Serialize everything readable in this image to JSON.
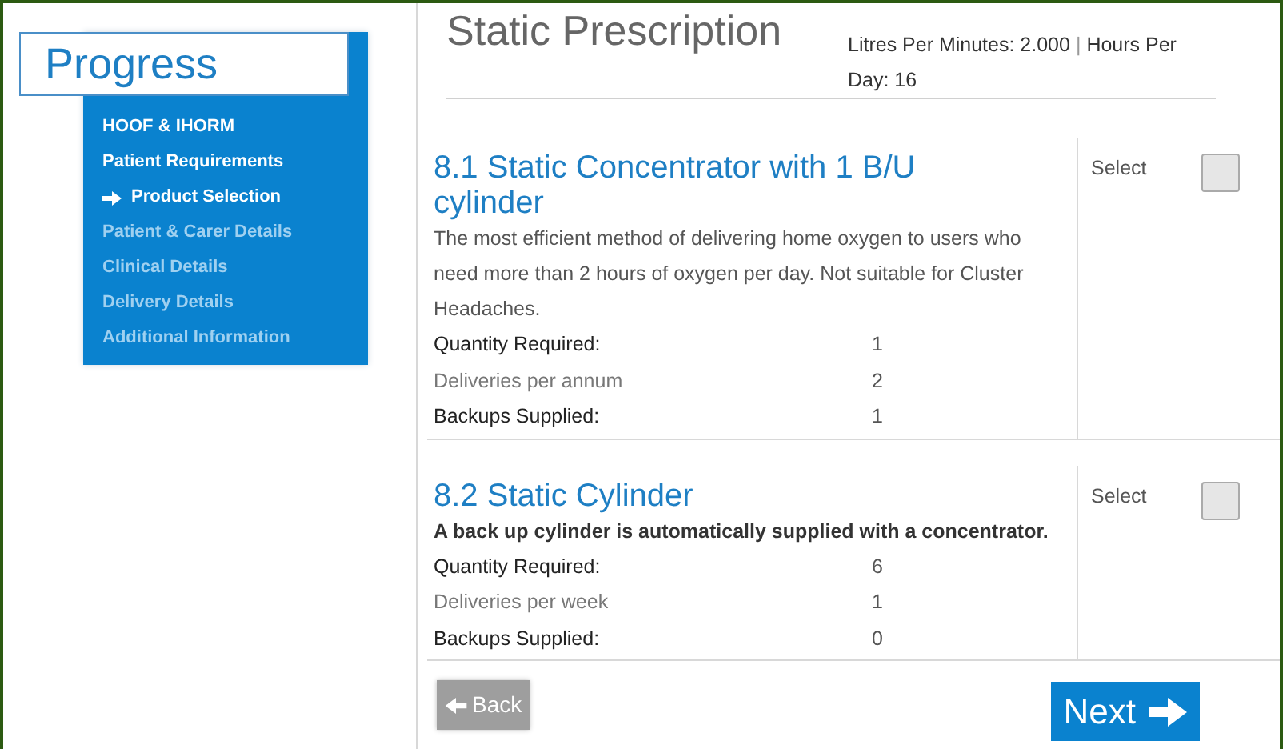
{
  "progress": {
    "title": "Progress",
    "steps": [
      {
        "label": "HOOF & IHORM",
        "kind": "done"
      },
      {
        "label": "Patient Requirements",
        "kind": "done"
      },
      {
        "label": "Product Selection",
        "kind": "current"
      },
      {
        "label": "Patient & Carer Details",
        "kind": "pending"
      },
      {
        "label": "Clinical Details",
        "kind": "pending"
      },
      {
        "label": "Delivery Details",
        "kind": "pending"
      },
      {
        "label": "Additional Information",
        "kind": "pending"
      }
    ]
  },
  "header": {
    "title": "Static Prescription",
    "litres": "Litres Per Minutes: 2.000",
    "separator": "|",
    "hours": "Hours Per Day: 16"
  },
  "products": [
    {
      "title": "8.1 Static Concentrator with 1 B/U cylinder",
      "description": "The most efficient method of delivering home oxygen to users who need more than 2 hours of oxygen per day. Not suitable for Cluster Headaches.",
      "description_bold": false,
      "select_label": "Select",
      "checked": false,
      "details": [
        {
          "label": "Quantity Required:",
          "value": "1",
          "strong": true
        },
        {
          "label": "Deliveries per annum",
          "value": "2",
          "strong": false
        },
        {
          "label": "Backups Supplied:",
          "value": "1",
          "strong": true
        }
      ]
    },
    {
      "title": "8.2 Static Cylinder",
      "description": "A back up cylinder is automatically supplied with a concentrator.",
      "description_bold": true,
      "select_label": "Select",
      "checked": false,
      "details": [
        {
          "label": "Quantity Required:",
          "value": "6",
          "strong": true
        },
        {
          "label": "Deliveries per week",
          "value": "1",
          "strong": false
        },
        {
          "label": "Backups Supplied:",
          "value": "0",
          "strong": true
        }
      ]
    }
  ],
  "back_button": "Back",
  "next_button": "Next"
}
